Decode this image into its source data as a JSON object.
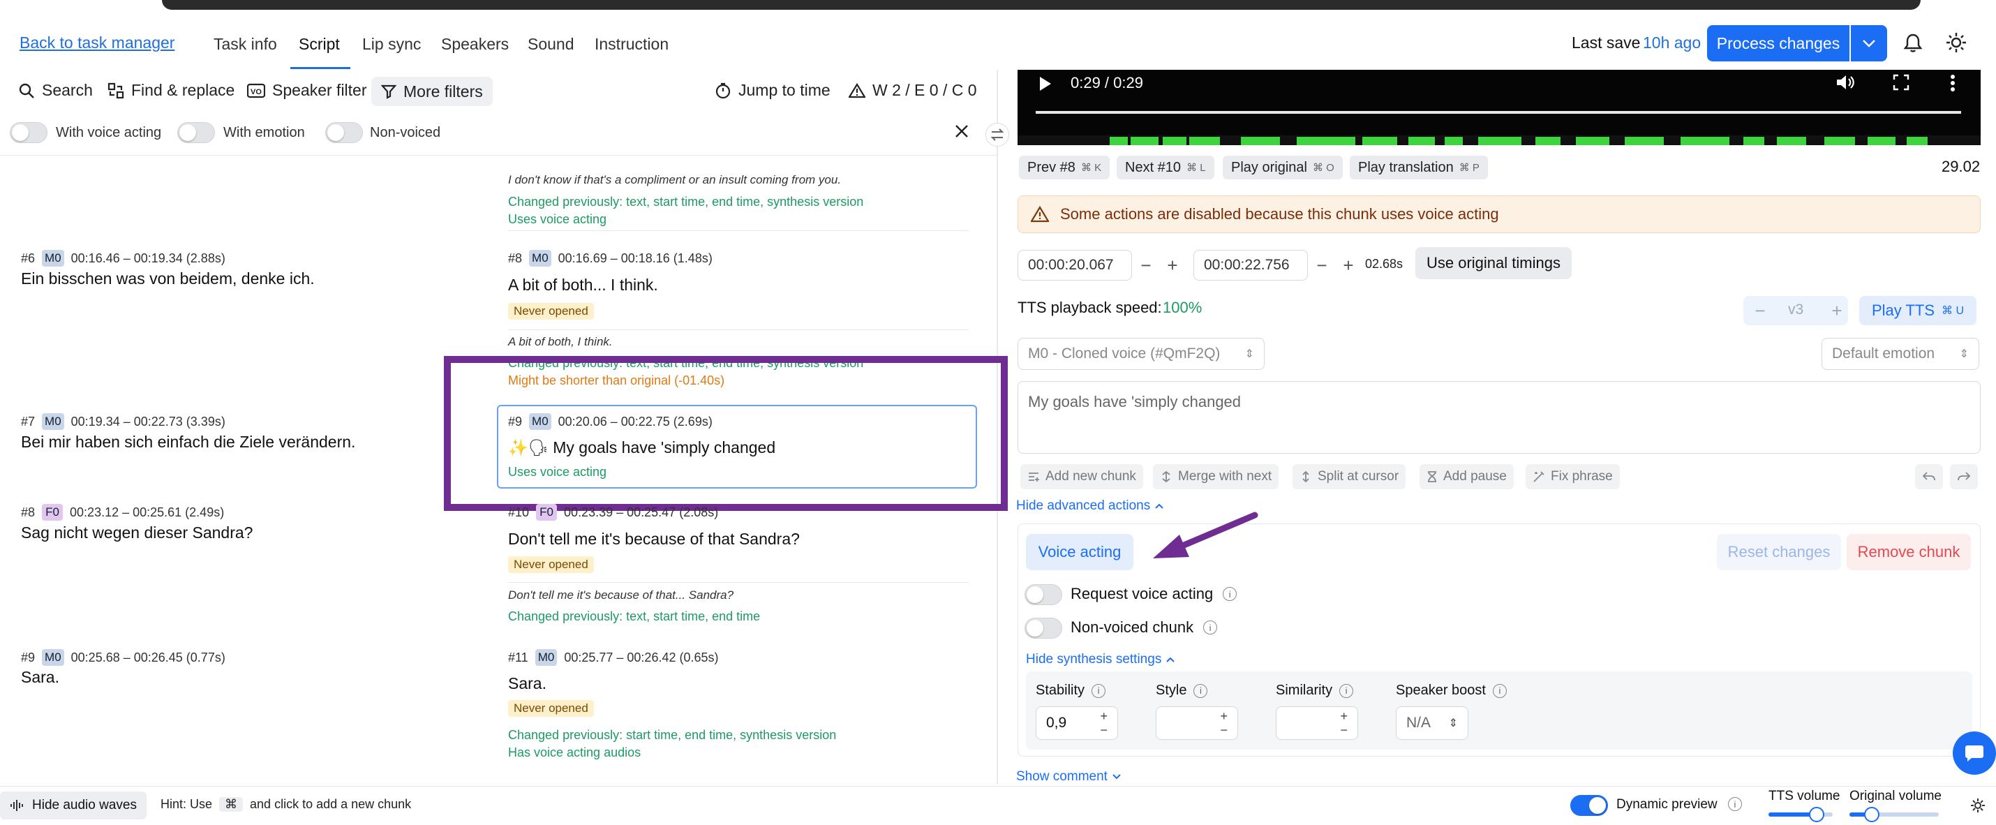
{
  "header": {
    "back_link": "Back to task manager",
    "tabs": [
      "Task info",
      "Script",
      "Lip sync",
      "Speakers",
      "Sound",
      "Instruction"
    ],
    "active_tab": "Script",
    "last_save_label": "Last save",
    "last_save_time": "10h ago",
    "process_button": "Process changes"
  },
  "toolbar": {
    "search": "Search",
    "find_replace": "Find & replace",
    "speaker_filter": "Speaker filter",
    "more_filters": "More filters",
    "jump_to_time": "Jump to time",
    "warnings": "W 2 / E 0 / C 0"
  },
  "filters": {
    "with_voice_acting": "With voice acting",
    "with_emotion": "With emotion",
    "non_voiced": "Non-voiced"
  },
  "rows": {
    "r0": {
      "trans_text": "I don't know if that's a compliment or an insult coming from you.",
      "changed": "Changed previously: text, start time, end time, synthesis version",
      "uses_va": "Uses voice acting"
    },
    "r6": {
      "orig_num": "#6",
      "orig_speaker": "M0",
      "orig_time": "00:16.46 – 00:19.34 (2.88s)",
      "orig_text": "Ein bisschen was von beidem, denke ich.",
      "trans_num": "#8",
      "trans_speaker": "M0",
      "trans_time": "00:16.69 – 00:18.16 (1.48s)",
      "trans_text": "A bit of both... I think.",
      "never": "Never opened",
      "prev_text": "A bit of both, I think.",
      "changed": "Changed previously: text, start time, end time, synthesis version",
      "shorter": "Might be shorter than original (-01.40s)"
    },
    "r7": {
      "orig_num": "#7",
      "orig_speaker": "M0",
      "orig_time": "00:19.34 – 00:22.73 (3.39s)",
      "orig_text": "Bei mir haben sich einfach die Ziele verändern.",
      "trans_num": "#9",
      "trans_speaker": "M0",
      "trans_time": "00:20.06 – 00:22.75 (2.69s)",
      "trans_prefix": "✨🗣",
      "trans_text": "My goals have 'simply changed",
      "uses_va": "Uses voice acting"
    },
    "r8": {
      "orig_num": "#8",
      "orig_speaker": "F0",
      "orig_time": "00:23.12 – 00:25.61 (2.49s)",
      "orig_text": "Sag nicht wegen dieser Sandra?",
      "trans_num": "#10",
      "trans_speaker": "F0",
      "trans_time": "00:23.39 – 00:25.47 (2.08s)",
      "trans_text": "Don't tell me it's because of that Sandra?",
      "never": "Never opened",
      "prev_text": "Don't tell me it's because of that... Sandra?",
      "changed": "Changed previously: text, start time, end time"
    },
    "r9": {
      "orig_num": "#9",
      "orig_speaker": "M0",
      "orig_time": "00:25.68 – 00:26.45 (0.77s)",
      "orig_text": "Sara.",
      "trans_num": "#11",
      "trans_speaker": "M0",
      "trans_time": "00:25.77 – 00:26.42 (0.65s)",
      "trans_text": "Sara.",
      "never": "Never opened",
      "changed": "Changed previously: start time, end time, synthesis version",
      "has_audios": "Has voice acting audios"
    }
  },
  "player": {
    "time": "0:29 / 0:29",
    "prev": "Prev #8",
    "prev_kbd": "⌘ K",
    "next": "Next #10",
    "next_kbd": "⌘ L",
    "play_original": "Play original",
    "play_original_kbd": "⌘ O",
    "play_translation": "Play translation",
    "play_translation_kbd": "⌘ P",
    "position_value": "29.02",
    "progress": 1.0
  },
  "editor": {
    "warning": "Some actions are disabled because this chunk uses voice acting",
    "start_time": "00:00:20.067",
    "end_time": "00:00:22.756",
    "duration": "02.68s",
    "use_original_timings": "Use original timings",
    "tts_speed_label": "TTS playback speed:",
    "tts_speed_value": "100%",
    "version": "v3",
    "play_tts": "Play TTS",
    "play_tts_kbd": "⌘ U",
    "voice_select": "M0 - Cloned voice (#QmF2Q)",
    "emotion_select": "Default emotion",
    "text_value": "My goals have 'simply changed",
    "actions": [
      "Add new chunk",
      "Merge with next",
      "Split at cursor",
      "Add pause",
      "Fix phrase"
    ],
    "hide_advanced": "Hide advanced actions",
    "voice_acting_btn": "Voice acting",
    "reset_changes": "Reset changes",
    "remove_chunk": "Remove chunk",
    "request_va": "Request voice acting",
    "non_voiced_chunk": "Non-voiced chunk",
    "hide_synthesis": "Hide synthesis settings",
    "stability_label": "Stability",
    "stability_value": "0,9",
    "style_label": "Style",
    "similarity_label": "Similarity",
    "speaker_boost_label": "Speaker boost",
    "speaker_boost_value": "N/A",
    "show_comment": "Show comment"
  },
  "footer": {
    "hide_waves": "Hide audio waves",
    "hint_prefix": "Hint: Use",
    "hint_key": "⌘",
    "hint_suffix": "and click to add a new chunk",
    "dynamic_preview": "Dynamic preview",
    "tts_volume": "TTS volume",
    "original_volume": "Original volume",
    "tts_volume_level": 0.75,
    "original_volume_level": 0.25
  },
  "colors": {
    "accent": "#1b6ef3",
    "highlight_frame": "#6f2c91",
    "green": "#1d9a64",
    "orange": "#e17a13",
    "danger": "#e5484d"
  }
}
